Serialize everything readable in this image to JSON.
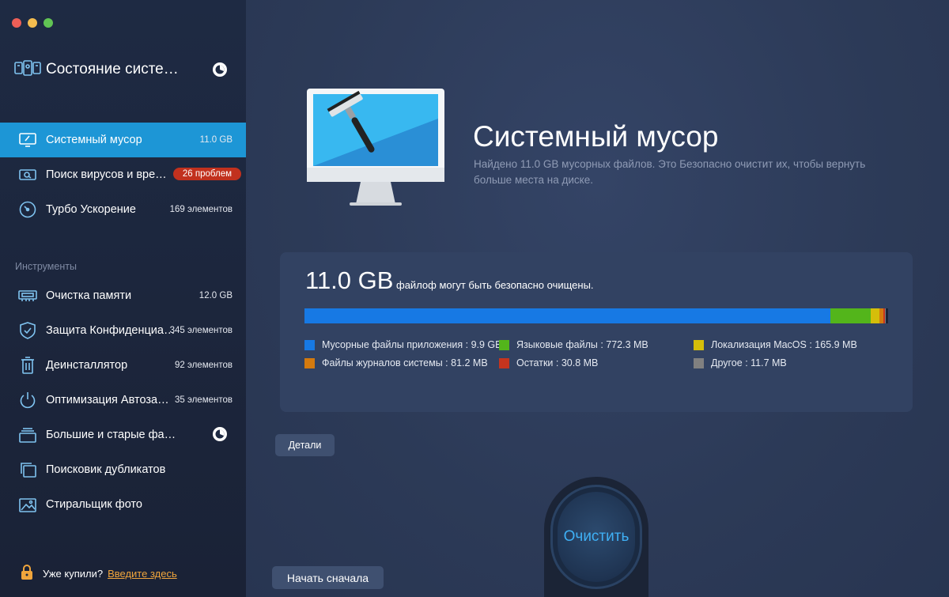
{
  "window": {
    "title": "Состояние систе…"
  },
  "sidebar": {
    "items": [
      {
        "label": "Системный мусор",
        "value": "11.0 GB"
      },
      {
        "label": "Поиск вирусов и вре…",
        "badge": "26 проблем"
      },
      {
        "label": "Турбо Ускорение",
        "value": "169 элементов"
      }
    ],
    "tools_label": "Инструменты",
    "tools": [
      {
        "label": "Очистка памяти",
        "value": "12.0 GB"
      },
      {
        "label": "Защита Конфиденциа…",
        "value": "345 элементов"
      },
      {
        "label": "Деинсталлятор",
        "value": "92 элементов"
      },
      {
        "label": "Оптимизация Автоза…",
        "value": "35 элементов"
      },
      {
        "label": "Большие и старые фа…"
      },
      {
        "label": "Поисковик дубликатов"
      },
      {
        "label": "Стиральщик фото"
      }
    ],
    "footer": {
      "text": "Уже купили?",
      "link": "Введите здесь"
    }
  },
  "main": {
    "title": "Системный мусор",
    "description": "Найдено 11.0 GB мусорных файлов.  Это Безопасно очистит их, чтобы вернуть больше места на диске.",
    "summary": {
      "size": "11.0 GB",
      "text": "файлоф могут быть безопасно очищены."
    },
    "breakdown": [
      {
        "label": "Мусорные файлы приложения : 9.9 GB",
        "color": "#1779e4",
        "fraction": 0.9014
      },
      {
        "label": "Языковые файлы : 772.3 MB",
        "color": "#53b51b",
        "fraction": 0.0687
      },
      {
        "label": "Локализация MacOS : 165.9 MB",
        "color": "#d5be0a",
        "fraction": 0.0148
      },
      {
        "label": "Файлы журналов системы : 81.2 MB",
        "color": "#d47a0e",
        "fraction": 0.0072
      },
      {
        "label": "Остатки : 30.8 MB",
        "color": "#c5341e",
        "fraction": 0.0027
      },
      {
        "label": "Другое : 11.7 MB",
        "color": "#808080",
        "fraction": 0.001
      }
    ],
    "details_label": "Детали",
    "clean_label": "Очистить",
    "restart_label": "Начать сначала"
  }
}
